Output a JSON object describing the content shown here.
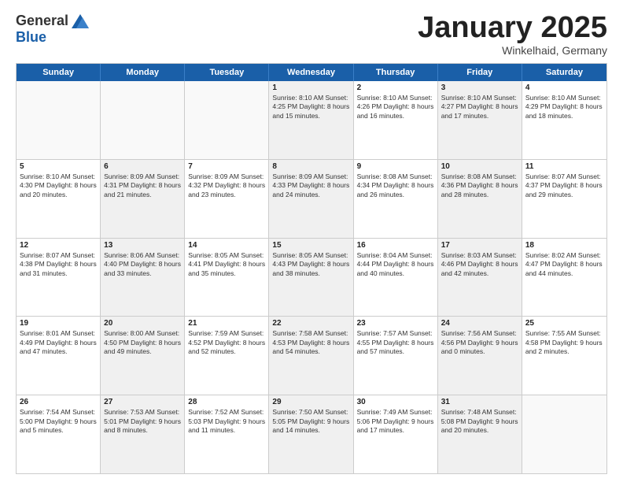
{
  "logo": {
    "general": "General",
    "blue": "Blue"
  },
  "title": "January 2025",
  "subtitle": "Winkelhaid, Germany",
  "days": [
    "Sunday",
    "Monday",
    "Tuesday",
    "Wednesday",
    "Thursday",
    "Friday",
    "Saturday"
  ],
  "rows": [
    [
      {
        "day": "",
        "info": "",
        "empty": true
      },
      {
        "day": "",
        "info": "",
        "empty": true
      },
      {
        "day": "",
        "info": "",
        "empty": true
      },
      {
        "day": "1",
        "info": "Sunrise: 8:10 AM\nSunset: 4:25 PM\nDaylight: 8 hours\nand 15 minutes.",
        "shaded": true
      },
      {
        "day": "2",
        "info": "Sunrise: 8:10 AM\nSunset: 4:26 PM\nDaylight: 8 hours\nand 16 minutes."
      },
      {
        "day": "3",
        "info": "Sunrise: 8:10 AM\nSunset: 4:27 PM\nDaylight: 8 hours\nand 17 minutes.",
        "shaded": true
      },
      {
        "day": "4",
        "info": "Sunrise: 8:10 AM\nSunset: 4:29 PM\nDaylight: 8 hours\nand 18 minutes."
      }
    ],
    [
      {
        "day": "5",
        "info": "Sunrise: 8:10 AM\nSunset: 4:30 PM\nDaylight: 8 hours\nand 20 minutes."
      },
      {
        "day": "6",
        "info": "Sunrise: 8:09 AM\nSunset: 4:31 PM\nDaylight: 8 hours\nand 21 minutes.",
        "shaded": true
      },
      {
        "day": "7",
        "info": "Sunrise: 8:09 AM\nSunset: 4:32 PM\nDaylight: 8 hours\nand 23 minutes."
      },
      {
        "day": "8",
        "info": "Sunrise: 8:09 AM\nSunset: 4:33 PM\nDaylight: 8 hours\nand 24 minutes.",
        "shaded": true
      },
      {
        "day": "9",
        "info": "Sunrise: 8:08 AM\nSunset: 4:34 PM\nDaylight: 8 hours\nand 26 minutes."
      },
      {
        "day": "10",
        "info": "Sunrise: 8:08 AM\nSunset: 4:36 PM\nDaylight: 8 hours\nand 28 minutes.",
        "shaded": true
      },
      {
        "day": "11",
        "info": "Sunrise: 8:07 AM\nSunset: 4:37 PM\nDaylight: 8 hours\nand 29 minutes."
      }
    ],
    [
      {
        "day": "12",
        "info": "Sunrise: 8:07 AM\nSunset: 4:38 PM\nDaylight: 8 hours\nand 31 minutes."
      },
      {
        "day": "13",
        "info": "Sunrise: 8:06 AM\nSunset: 4:40 PM\nDaylight: 8 hours\nand 33 minutes.",
        "shaded": true
      },
      {
        "day": "14",
        "info": "Sunrise: 8:05 AM\nSunset: 4:41 PM\nDaylight: 8 hours\nand 35 minutes."
      },
      {
        "day": "15",
        "info": "Sunrise: 8:05 AM\nSunset: 4:43 PM\nDaylight: 8 hours\nand 38 minutes.",
        "shaded": true
      },
      {
        "day": "16",
        "info": "Sunrise: 8:04 AM\nSunset: 4:44 PM\nDaylight: 8 hours\nand 40 minutes."
      },
      {
        "day": "17",
        "info": "Sunrise: 8:03 AM\nSunset: 4:46 PM\nDaylight: 8 hours\nand 42 minutes.",
        "shaded": true
      },
      {
        "day": "18",
        "info": "Sunrise: 8:02 AM\nSunset: 4:47 PM\nDaylight: 8 hours\nand 44 minutes."
      }
    ],
    [
      {
        "day": "19",
        "info": "Sunrise: 8:01 AM\nSunset: 4:49 PM\nDaylight: 8 hours\nand 47 minutes."
      },
      {
        "day": "20",
        "info": "Sunrise: 8:00 AM\nSunset: 4:50 PM\nDaylight: 8 hours\nand 49 minutes.",
        "shaded": true
      },
      {
        "day": "21",
        "info": "Sunrise: 7:59 AM\nSunset: 4:52 PM\nDaylight: 8 hours\nand 52 minutes."
      },
      {
        "day": "22",
        "info": "Sunrise: 7:58 AM\nSunset: 4:53 PM\nDaylight: 8 hours\nand 54 minutes.",
        "shaded": true
      },
      {
        "day": "23",
        "info": "Sunrise: 7:57 AM\nSunset: 4:55 PM\nDaylight: 8 hours\nand 57 minutes."
      },
      {
        "day": "24",
        "info": "Sunrise: 7:56 AM\nSunset: 4:56 PM\nDaylight: 9 hours\nand 0 minutes.",
        "shaded": true
      },
      {
        "day": "25",
        "info": "Sunrise: 7:55 AM\nSunset: 4:58 PM\nDaylight: 9 hours\nand 2 minutes."
      }
    ],
    [
      {
        "day": "26",
        "info": "Sunrise: 7:54 AM\nSunset: 5:00 PM\nDaylight: 9 hours\nand 5 minutes."
      },
      {
        "day": "27",
        "info": "Sunrise: 7:53 AM\nSunset: 5:01 PM\nDaylight: 9 hours\nand 8 minutes.",
        "shaded": true
      },
      {
        "day": "28",
        "info": "Sunrise: 7:52 AM\nSunset: 5:03 PM\nDaylight: 9 hours\nand 11 minutes."
      },
      {
        "day": "29",
        "info": "Sunrise: 7:50 AM\nSunset: 5:05 PM\nDaylight: 9 hours\nand 14 minutes.",
        "shaded": true
      },
      {
        "day": "30",
        "info": "Sunrise: 7:49 AM\nSunset: 5:06 PM\nDaylight: 9 hours\nand 17 minutes."
      },
      {
        "day": "31",
        "info": "Sunrise: 7:48 AM\nSunset: 5:08 PM\nDaylight: 9 hours\nand 20 minutes.",
        "shaded": true
      },
      {
        "day": "",
        "info": "",
        "empty": true
      }
    ]
  ]
}
